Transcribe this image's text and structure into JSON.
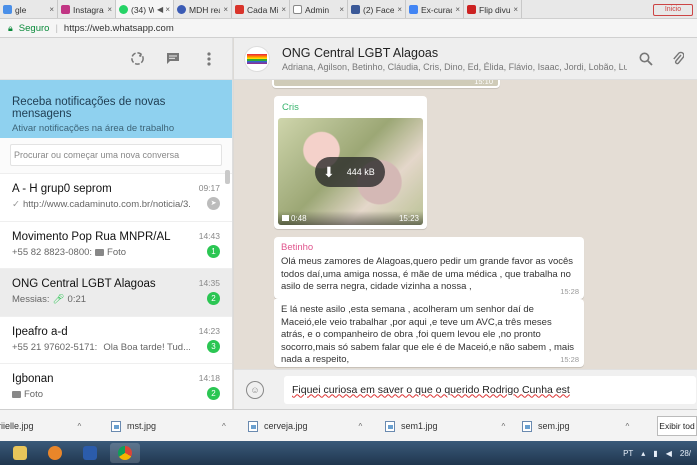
{
  "browser": {
    "tabs": [
      {
        "label": "gle",
        "color": "#4a8fe8",
        "close": "×"
      },
      {
        "label": "Instagram",
        "color": "#c13584",
        "close": "×"
      },
      {
        "label": "(34) W",
        "color": "#25d366",
        "close": "◀ ×"
      },
      {
        "label": "MDH real",
        "color": "#3b5bb5",
        "close": "×"
      },
      {
        "label": "Cada Min",
        "color": "#d9342b",
        "close": "×"
      },
      {
        "label": "Admin",
        "color": "#888888",
        "close": "×"
      },
      {
        "label": "(2) Faceb",
        "color": "#3b5998",
        "close": "×"
      },
      {
        "label": "Ex-curado",
        "color": "#4285f4",
        "close": "×"
      },
      {
        "label": "Flip divulg",
        "color": "#cc2222",
        "close": "×"
      }
    ],
    "window_badge": "Inicio",
    "address": {
      "secure_label": "Seguro",
      "url": "https://web.whatsapp.com"
    }
  },
  "left": {
    "header_icons": [
      "status-icon",
      "new-chat-icon",
      "menu-icon"
    ],
    "notification": {
      "title": "Receba notificações de novas mensagens",
      "subtitle": "Ativar notificações na área de trabalho"
    },
    "search_placeholder": "Procurar ou começar uma nova conversa",
    "chats": [
      {
        "name": "A - H grup0 seprom i",
        "display_name": "A - H grup0 seprom",
        "preview": "http://www.cadaminuto.com.br/noticia/3...",
        "time": "09:17",
        "badge": "",
        "prefix": "✓",
        "muted": true
      },
      {
        "name": "Movimento Pop Rua MNPR/AL",
        "display_name": "Movimento Pop Rua MNPR/AL",
        "preview": "+55 82 8823-0800:",
        "preview_tail": "Foto",
        "time": "14:43",
        "badge": "1",
        "prefix": "",
        "muted": false
      },
      {
        "name": "ONG Central LGBT Alagoas",
        "display_name": "ONG Central LGBT Alagoas",
        "preview": "Messias:",
        "preview_tail": "0:21",
        "time": "14:35",
        "badge": "2",
        "prefix": "",
        "muted": false
      },
      {
        "name": "Ipeafro a-d",
        "display_name": "Ipeafro a-d",
        "preview": "+55 21 97602-5171:",
        "preview_tail": "Ola Boa tarde! Tud...",
        "time": "14:23",
        "badge": "3",
        "prefix": "",
        "muted": false
      },
      {
        "name": "Igbonan",
        "display_name": "Igbonan",
        "preview": "",
        "preview_tail": "Foto",
        "time": "14:18",
        "badge": "2",
        "prefix": "",
        "muted": false
      }
    ]
  },
  "conversation": {
    "group_name": "ONG Central LGBT Alagoas",
    "members": "Adriana, Agilson, Betinho, Cláudia, Cris, Dino, Ed, Élida, Flávio, Isaac, Jordi, Lobão, Luci, ...",
    "prev_time": "15:10",
    "messages": [
      {
        "sender": "Cris",
        "sender_color": "#35b36b",
        "type": "video",
        "size": "444 kB",
        "duration": "0:48",
        "time": "15:23"
      },
      {
        "sender": "Betinho",
        "sender_color": "#e0558d",
        "type": "text",
        "text": "Olá meus zamores de Alagoas,quero pedir um grande favor as vocês todos daí,uma amiga nossa, é mãe de uma médica , que trabalha no asilo de serra negra, cidade vizinha a nossa ,",
        "time": "15:28"
      },
      {
        "sender": "",
        "type": "text",
        "text": "E lá neste asilo ,esta semana , acolheram um senhor daí de Maceió,ele veio trabalhar ,por aqui ,e teve um AVC,a três meses atrás, e o companheiro de obra ,foi quem levou ele ,no pronto socorro,mais só sabem falar que ele é de Maceió,e não sabem , mais nada a respeito,",
        "time": "15:28"
      }
    ],
    "compose_text": "Fiquei curiosa em saver o que o querido Rodrigo Cunha est"
  },
  "downloads": {
    "items": [
      {
        "name": "riielle.jpg"
      },
      {
        "name": "mst.jpg"
      },
      {
        "name": "cerveja.jpg"
      },
      {
        "name": "sem1.jpg"
      },
      {
        "name": "sem.jpg"
      }
    ],
    "show_all": "Exibir tod"
  },
  "taskbar": {
    "lang": "PT",
    "clock": "28/"
  }
}
